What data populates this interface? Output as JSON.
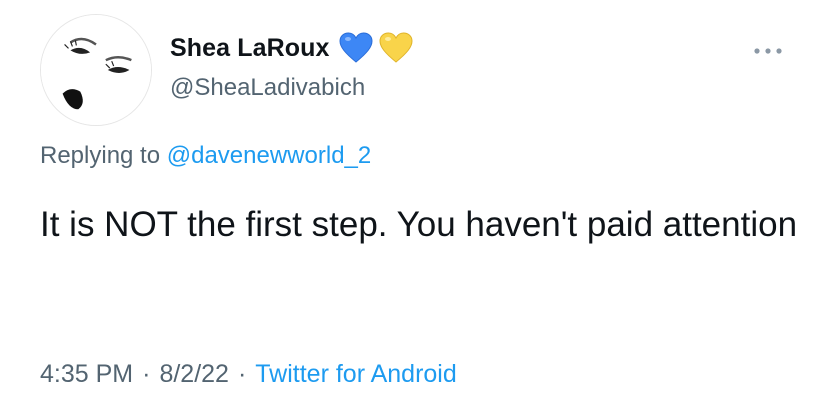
{
  "author": {
    "display_name": "Shea LaRoux",
    "handle": "@SheaLadivabich",
    "badges": [
      {
        "icon": "blue-heart-icon",
        "color": "#3d87f5"
      },
      {
        "icon": "yellow-heart-icon",
        "color": "#f9d44a"
      }
    ]
  },
  "reply": {
    "prefix": "Replying to ",
    "to_handle": "@davenewworld_2"
  },
  "tweet": {
    "text": "It is NOT the first step. You haven't paid attention"
  },
  "meta": {
    "time": "4:35 PM",
    "separator": "·",
    "date": "8/2/22",
    "source": "Twitter for Android"
  },
  "colors": {
    "link": "#1d9bf0",
    "secondary_text": "#536471",
    "primary_text": "#0f1419"
  }
}
